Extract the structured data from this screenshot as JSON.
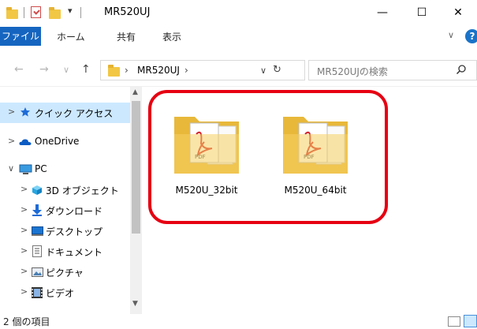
{
  "window": {
    "title": "MR520UJ",
    "quick_access_dropdown": "▾",
    "minimize_glyph": "—",
    "maximize_glyph": "☐",
    "close_glyph": "✕"
  },
  "ribbon": {
    "tabs": [
      "ファイル",
      "ホーム",
      "共有",
      "表示"
    ],
    "expand_glyph": "∨",
    "help_glyph": "?"
  },
  "address": {
    "back_glyph": "←",
    "forward_glyph": "→",
    "recent_glyph": "∨",
    "up_glyph": "↑",
    "path": "MR520UJ",
    "separator": "›",
    "dropdown_glyph": "∨",
    "refresh_glyph": "↻"
  },
  "search": {
    "placeholder": "MR520UJの検索"
  },
  "nav_pane": {
    "items": [
      {
        "label": "クイック アクセス",
        "icon": "star-icon",
        "chevron": ">",
        "selected": true
      },
      {
        "label": "OneDrive",
        "icon": "cloud-icon",
        "chevron": ">"
      },
      {
        "label": "PC",
        "icon": "monitor-icon",
        "chevron": "∨"
      },
      {
        "label": "3D オブジェクト",
        "icon": "cube-icon",
        "chevron": ">"
      },
      {
        "label": "ダウンロード",
        "icon": "download-arrow-icon",
        "chevron": ">"
      },
      {
        "label": "デスクトップ",
        "icon": "desktop-icon",
        "chevron": ">"
      },
      {
        "label": "ドキュメント",
        "icon": "document-icon",
        "chevron": ">"
      },
      {
        "label": "ピクチャ",
        "icon": "picture-icon",
        "chevron": ">"
      },
      {
        "label": "ビデオ",
        "icon": "film-icon",
        "chevron": ">"
      }
    ]
  },
  "files": [
    {
      "name": "M520U_32bit",
      "icon": "folder-pdf-icon"
    },
    {
      "name": "M520U_64bit",
      "icon": "folder-pdf-icon"
    }
  ],
  "status": {
    "item_count": "2 個の項目"
  },
  "colors": {
    "file_tab": "#1565c0",
    "highlight": "#e60012",
    "folder": "#f2c744",
    "selected_nav": "#cce8ff"
  }
}
